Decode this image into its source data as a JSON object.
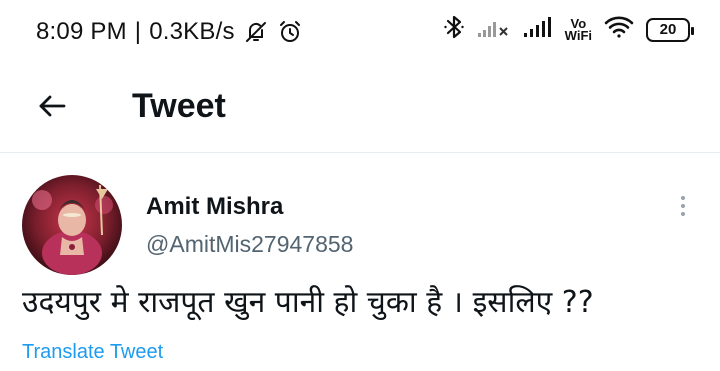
{
  "status_bar": {
    "time": "8:09 PM",
    "speed": "0.3KB/s",
    "separator": "|",
    "vowifi_top": "Vo",
    "vowifi_bottom": "WiFi",
    "battery": "20"
  },
  "header": {
    "title": "Tweet"
  },
  "tweet": {
    "display_name": "Amit Mishra",
    "handle": "@AmitMis27947858",
    "text": "उदयपुर मे राजपूत खुन पानी हो चुका है । इसलिए ??",
    "translate_label": "Translate Tweet"
  },
  "colors": {
    "link": "#1d9bf0",
    "secondary_text": "#536471",
    "primary_text": "#0f1419"
  },
  "icons": {
    "back": "arrow-left-icon",
    "more": "more-vertical-icon",
    "mute": "bell-off-icon",
    "alarm": "alarm-icon",
    "bluetooth": "bluetooth-icon",
    "signal": "signal-icon",
    "wifi": "wifi-icon",
    "battery": "battery-icon"
  }
}
